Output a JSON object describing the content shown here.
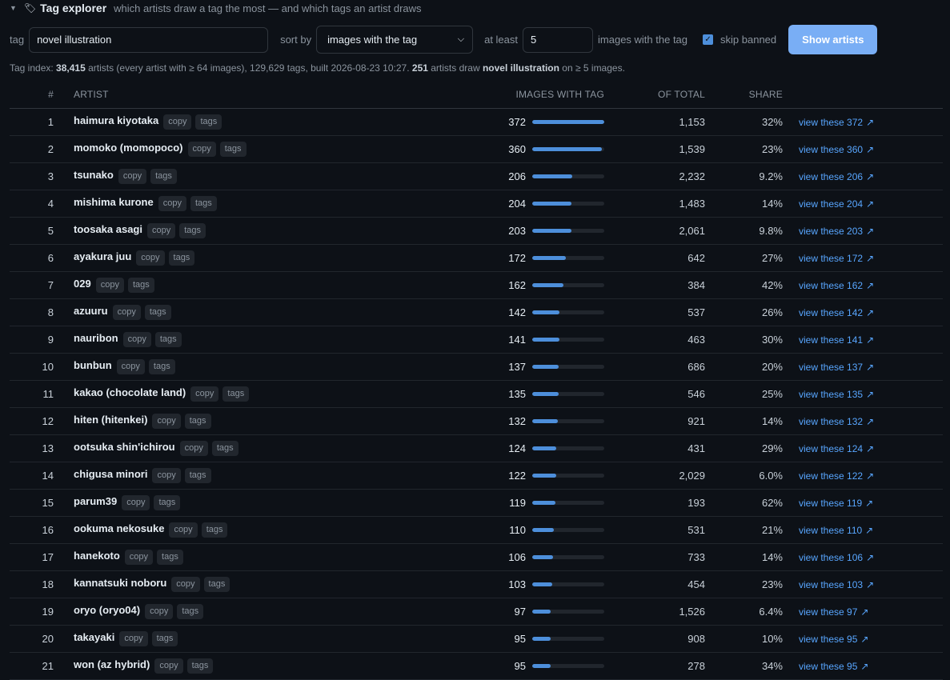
{
  "header": {
    "title": "Tag explorer",
    "subtitle": "which artists draw a tag the most — and which tags an artist draws"
  },
  "controls": {
    "tag_label": "tag",
    "tag_value": "novel illustration",
    "sortby_label": "sort by",
    "sort_value": "images with the tag",
    "atleast_label": "at least",
    "atleast_value": "5",
    "images_label": "images with the tag",
    "skip_label": "skip banned",
    "skip_checked": true,
    "button_label": "Show artists"
  },
  "info": {
    "p1": "Tag index: ",
    "artists": "38,415",
    "p2": " artists (every artist with ≥ 64 images), 129,629 tags, built 2026-08-23 10:27. ",
    "count": "251",
    "p3": " artists draw ",
    "tag": "novel illustration",
    "p4": " on ≥ 5 images."
  },
  "table": {
    "headers": [
      "#",
      "Artist",
      "Images with tag",
      "Of total",
      "Share"
    ],
    "copy_label": "copy",
    "tags_label": "tags",
    "bar_max": 372,
    "rows": [
      {
        "rank": "1",
        "artist": "haimura kiyotaka",
        "images": 372,
        "total": "1,153",
        "share": "32%",
        "view": "view these 372"
      },
      {
        "rank": "2",
        "artist": "momoko (momopoco)",
        "images": 360,
        "total": "1,539",
        "share": "23%",
        "view": "view these 360"
      },
      {
        "rank": "3",
        "artist": "tsunako",
        "images": 206,
        "total": "2,232",
        "share": "9.2%",
        "view": "view these 206"
      },
      {
        "rank": "4",
        "artist": "mishima kurone",
        "images": 204,
        "total": "1,483",
        "share": "14%",
        "view": "view these 204"
      },
      {
        "rank": "5",
        "artist": "toosaka asagi",
        "images": 203,
        "total": "2,061",
        "share": "9.8%",
        "view": "view these 203"
      },
      {
        "rank": "6",
        "artist": "ayakura juu",
        "images": 172,
        "total": "642",
        "share": "27%",
        "view": "view these 172"
      },
      {
        "rank": "7",
        "artist": "029",
        "images": 162,
        "total": "384",
        "share": "42%",
        "view": "view these 162"
      },
      {
        "rank": "8",
        "artist": "azuuru",
        "images": 142,
        "total": "537",
        "share": "26%",
        "view": "view these 142"
      },
      {
        "rank": "9",
        "artist": "nauribon",
        "images": 141,
        "total": "463",
        "share": "30%",
        "view": "view these 141"
      },
      {
        "rank": "10",
        "artist": "bunbun",
        "images": 137,
        "total": "686",
        "share": "20%",
        "view": "view these 137"
      },
      {
        "rank": "11",
        "artist": "kakao (chocolate land)",
        "images": 135,
        "total": "546",
        "share": "25%",
        "view": "view these 135"
      },
      {
        "rank": "12",
        "artist": "hiten (hitenkei)",
        "images": 132,
        "total": "921",
        "share": "14%",
        "view": "view these 132"
      },
      {
        "rank": "13",
        "artist": "ootsuka shin'ichirou",
        "images": 124,
        "total": "431",
        "share": "29%",
        "view": "view these 124"
      },
      {
        "rank": "14",
        "artist": "chigusa minori",
        "images": 122,
        "total": "2,029",
        "share": "6.0%",
        "view": "view these 122"
      },
      {
        "rank": "15",
        "artist": "parum39",
        "images": 119,
        "total": "193",
        "share": "62%",
        "view": "view these 119"
      },
      {
        "rank": "16",
        "artist": "ookuma nekosuke",
        "images": 110,
        "total": "531",
        "share": "21%",
        "view": "view these 110"
      },
      {
        "rank": "17",
        "artist": "hanekoto",
        "images": 106,
        "total": "733",
        "share": "14%",
        "view": "view these 106"
      },
      {
        "rank": "18",
        "artist": "kannatsuki noboru",
        "images": 103,
        "total": "454",
        "share": "23%",
        "view": "view these 103"
      },
      {
        "rank": "19",
        "artist": "oryo (oryo04)",
        "images": 97,
        "total": "1,526",
        "share": "6.4%",
        "view": "view these 97"
      },
      {
        "rank": "20",
        "artist": "takayaki",
        "images": 95,
        "total": "908",
        "share": "10%",
        "view": "view these 95"
      },
      {
        "rank": "21",
        "artist": "won (az hybrid)",
        "images": 95,
        "total": "278",
        "share": "34%",
        "view": "view these 95"
      }
    ]
  }
}
